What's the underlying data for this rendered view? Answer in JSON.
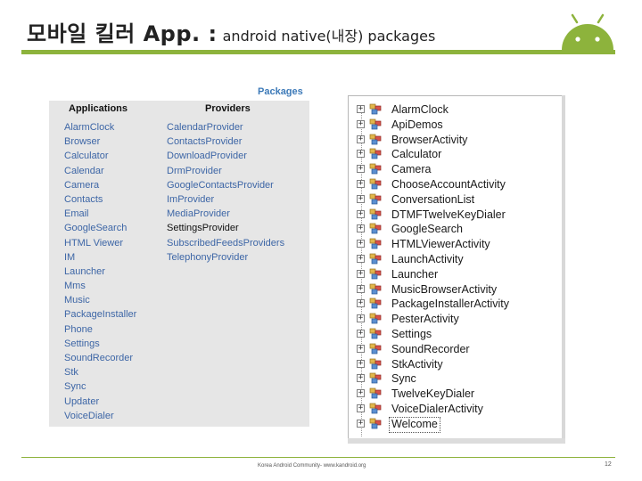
{
  "header": {
    "title_main": "모바일 킬러 App. :",
    "title_sub": "android native(내장) packages"
  },
  "colors": {
    "accent": "#8db33c",
    "link": "#3d66a6",
    "heading_blue": "#3d7ab8"
  },
  "packages_table": {
    "title": "Packages",
    "applications_header": "Applications",
    "providers_header": "Providers",
    "applications": [
      "AlarmClock",
      "Browser",
      "Calculator",
      "Calendar",
      "Camera",
      "Contacts",
      "Email",
      "GoogleSearch",
      "HTML Viewer",
      "IM",
      "Launcher",
      "Mms",
      "Music",
      "PackageInstaller",
      "Phone",
      "Settings",
      "SoundRecorder",
      "Stk",
      "Sync",
      "Updater",
      "VoiceDialer"
    ],
    "providers": [
      "CalendarProvider",
      "ContactsProvider",
      "DownloadProvider",
      "DrmProvider",
      "GoogleContactsProvider",
      "ImProvider",
      "MediaProvider",
      "SettingsProvider",
      "SubscribedFeedsProviders",
      "TelephonyProvider"
    ]
  },
  "tree": {
    "expand_glyph": "+",
    "items": [
      "AlarmClock",
      "ApiDemos",
      "BrowserActivity",
      "Calculator",
      "Camera",
      "ChooseAccountActivity",
      "ConversationList",
      "DTMFTwelveKeyDialer",
      "GoogleSearch",
      "HTMLViewerActivity",
      "LaunchActivity",
      "Launcher",
      "MusicBrowserActivity",
      "PackageInstallerActivity",
      "PesterActivity",
      "Settings",
      "SoundRecorder",
      "StkActivity",
      "Sync",
      "TwelveKeyDialer",
      "VoiceDialerActivity",
      "Welcome"
    ]
  },
  "footer": {
    "text": "Korea Android Community- www.kandroid.org",
    "page": "12"
  }
}
